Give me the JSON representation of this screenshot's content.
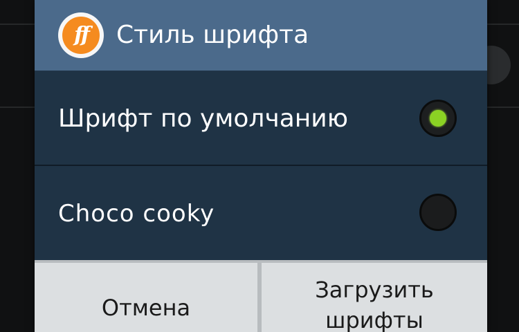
{
  "dialog": {
    "title": "Стиль шрифта",
    "app_icon": "ff-logo-icon",
    "options": [
      {
        "label": "Шрифт по умолчанию",
        "selected": true
      },
      {
        "label": "Choco cooky",
        "selected": false
      }
    ],
    "buttons": {
      "cancel": "Отмена",
      "download_line1": "Загрузить",
      "download_line2": "шрифты"
    }
  },
  "colors": {
    "title_bar": "#4b6a8b",
    "dialog_body": "#1f3345",
    "radio_selected": "#8bd224",
    "button_bg": "#dcdfe1",
    "logo_orange": "#f58b1f"
  }
}
